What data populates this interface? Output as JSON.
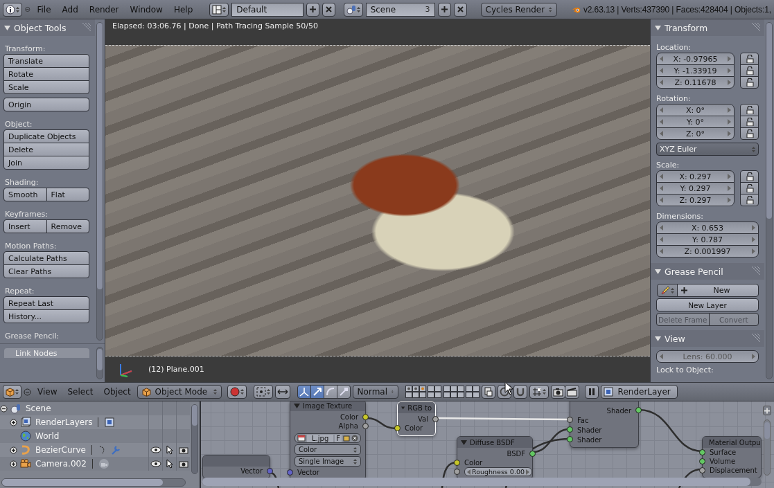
{
  "top_bar": {
    "menus": [
      "File",
      "Add",
      "Render",
      "Window",
      "Help"
    ],
    "screen_layout": "Default",
    "scene": "Scene",
    "scene_users": "3",
    "render_engine": "Cycles Render",
    "stats": "v2.63.13 | Verts:437390 | Faces:428404 | Objects:1,"
  },
  "tool_shelf": {
    "title": "Object Tools",
    "expanded": true,
    "sections": [
      {
        "label": "Transform:",
        "groups": [
          [
            [
              "Translate"
            ],
            [
              "Rotate"
            ],
            [
              "Scale"
            ]
          ],
          [
            [
              "Origin"
            ]
          ]
        ]
      },
      {
        "label": "Object:",
        "groups": [
          [
            [
              "Duplicate Objects"
            ],
            [
              "Delete"
            ],
            [
              "Join"
            ]
          ]
        ]
      },
      {
        "label": "Shading:",
        "groups": [
          [
            [
              "Smooth",
              "Flat"
            ]
          ]
        ]
      },
      {
        "label": "Keyframes:",
        "groups": [
          [
            [
              "Insert",
              "Remove"
            ]
          ]
        ]
      },
      {
        "label": "Motion Paths:",
        "groups": [
          [
            [
              "Calculate Paths"
            ],
            [
              "Clear Paths"
            ]
          ]
        ]
      },
      {
        "label": "Repeat:",
        "groups": [
          [
            [
              "Repeat Last"
            ],
            [
              "History..."
            ]
          ]
        ]
      },
      {
        "label": "Grease Pencil:"
      }
    ],
    "lower_item": "Link Nodes"
  },
  "viewport": {
    "status": "Elapsed: 03:06.76 | Done | Path Tracing Sample 50/50",
    "object_info": "(12) Plane.001"
  },
  "properties": {
    "panels": [
      {
        "title": "Transform",
        "expanded": true,
        "rows": [
          {
            "kind": "label",
            "text": "Location:"
          },
          {
            "kind": "vector",
            "fields": [
              {
                "text": "X: -0.97965",
                "locked": false
              },
              {
                "text": "Y: -1.33919",
                "locked": false
              },
              {
                "text": "Z: 0.11678",
                "locked": false
              }
            ]
          },
          {
            "kind": "label",
            "text": "Rotation:"
          },
          {
            "kind": "vector",
            "fields": [
              {
                "text": "X: 0°",
                "locked": false
              },
              {
                "text": "Y: 0°",
                "locked": false
              },
              {
                "text": "Z: 0°",
                "locked": false
              }
            ]
          },
          {
            "kind": "dropdown",
            "text": "XYZ Euler"
          },
          {
            "kind": "label",
            "text": "Scale:"
          },
          {
            "kind": "vector",
            "fields": [
              {
                "text": "X: 0.297",
                "locked": false
              },
              {
                "text": "Y: 0.297",
                "locked": false
              },
              {
                "text": "Z: 0.297",
                "locked": false
              }
            ]
          },
          {
            "kind": "label",
            "text": "Dimensions:"
          },
          {
            "kind": "vector",
            "fields": [
              {
                "text": "X: 0.653"
              },
              {
                "text": "Y: 0.787"
              },
              {
                "text": "Z: 0.001997"
              }
            ]
          }
        ]
      },
      {
        "title": "Grease Pencil",
        "expanded": true,
        "rows": [
          {
            "kind": "new",
            "text": "New"
          },
          {
            "kind": "buttons",
            "buttons": [
              {
                "text": "New Layer",
                "disabled": false
              }
            ]
          },
          {
            "kind": "buttons",
            "buttons": [
              {
                "text": "Delete Frame",
                "disabled": true
              },
              {
                "text": "Convert",
                "disabled": true
              }
            ]
          }
        ]
      },
      {
        "title": "View",
        "expanded": true,
        "rows": [
          {
            "kind": "slider",
            "text": "Lens: 60.000",
            "disabled": true
          },
          {
            "kind": "label",
            "text": "Lock to Object:"
          }
        ]
      }
    ]
  },
  "viewport_header": {
    "menus": [
      "View",
      "Select",
      "Object"
    ],
    "mode": "Object Mode",
    "orientation": "Normal",
    "render_layer": "RenderLayer"
  },
  "outliner": {
    "items": [
      {
        "name": "Scene",
        "kind": "scene",
        "expanded": true,
        "children": [
          {
            "name": "RenderLayers",
            "kind": "renderlayers",
            "expanded": false
          },
          {
            "name": "World",
            "kind": "world"
          },
          {
            "name": "BezierCurve",
            "kind": "curve",
            "expanded": false
          },
          {
            "name": "Camera.002",
            "kind": "camera",
            "expanded": false
          }
        ]
      }
    ]
  },
  "node_editor": {
    "nodes": [
      {
        "selected": false,
        "outputs": [
          {
            "name": "Vector",
            "color": "#6363c7"
          }
        ]
      },
      {
        "title": "Image Texture",
        "selected": false,
        "outputs": [
          {
            "name": "Color",
            "color": "#c7c729"
          },
          {
            "name": "Alpha",
            "color": "#a1a1a1"
          }
        ],
        "widgets": [
          {
            "kind": "image",
            "text": "L.jpg",
            "flag": "F"
          },
          {
            "kind": "dropdown",
            "text": "Color"
          },
          {
            "kind": "dropdown",
            "text": "Single Image"
          }
        ],
        "inputs": [
          {
            "name": "Vector",
            "color": "#6363c7",
            "kind": "socket"
          }
        ]
      },
      {
        "title": "RGB to",
        "selected": true,
        "outputs": [
          {
            "name": "Val",
            "color": "#a1a1a1"
          }
        ],
        "inputs": [
          {
            "name": "Color",
            "color": "#c7c729",
            "kind": "socket"
          }
        ]
      },
      {
        "title": "Diffuse BSDF",
        "selected": false,
        "outputs": [
          {
            "name": "BSDF",
            "color": "#63c763"
          }
        ],
        "inputs": [
          {
            "name": "Color",
            "color": "#c7c729",
            "kind": "socket"
          },
          {
            "name": "Roughness 0.00",
            "color": "#a1a1a1",
            "kind": "field"
          }
        ]
      },
      {
        "selected": false,
        "outputs": [
          {
            "name": "Shader",
            "color": "#63c763"
          }
        ],
        "inputs": [
          {
            "name": "Fac",
            "color": "#a1a1a1",
            "kind": "socket"
          },
          {
            "name": "Shader",
            "color": "#63c763",
            "kind": "socket"
          },
          {
            "name": "Shader",
            "color": "#63c763",
            "kind": "socket"
          }
        ]
      },
      {
        "title": "Material Outpu",
        "selected": false,
        "inputs": [
          {
            "name": "Surface",
            "color": "#63c763",
            "kind": "socket"
          },
          {
            "name": "Volume",
            "color": "#63c763",
            "kind": "socket"
          },
          {
            "name": "Displacement",
            "color": "#a1a1a1",
            "kind": "socket"
          }
        ]
      }
    ]
  }
}
